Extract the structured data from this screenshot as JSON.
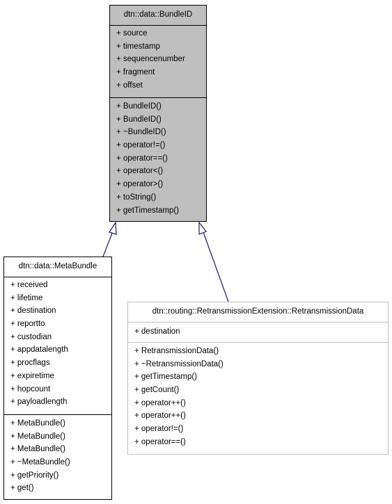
{
  "diagram": {
    "type": "class-inheritance",
    "edge_color": "#191970",
    "base_class": {
      "name": "dtn::data::BundleID",
      "fill": "#bfbfbf",
      "attributes": [
        "+ source",
        "+ timestamp",
        "+ sequencenumber",
        "+ fragment",
        "+ offset"
      ],
      "operations": [
        "+ BundleID()",
        "+ BundleID()",
        "+ ~BundleID()",
        "+ operator!=()",
        "+ operator==()",
        "+ operator<()",
        "+ operator>()",
        "+ toString()",
        "+ getTimestamp()"
      ]
    },
    "derived_classes": [
      {
        "name": "dtn::data::MetaBundle",
        "attributes": [
          "+ received",
          "+ lifetime",
          "+ destination",
          "+ reportto",
          "+ custodian",
          "+ appdatalength",
          "+ procflags",
          "+ expiretime",
          "+ hopcount",
          "+ payloadlength"
        ],
        "operations": [
          "+ MetaBundle()",
          "+ MetaBundle()",
          "+ MetaBundle()",
          "+ ~MetaBundle()",
          "+ getPriority()",
          "+ get()"
        ]
      },
      {
        "name": "dtn::routing::RetransmissionExtension::RetransmissionData",
        "attributes": [
          "+ destination"
        ],
        "operations": [
          "+ RetransmissionData()",
          "+ ~RetransmissionData()",
          "+ getTimestamp()",
          "+ getCount()",
          "+ operator++()",
          "+ operator++()",
          "+ operator!=()",
          "+ operator==()"
        ]
      }
    ]
  }
}
